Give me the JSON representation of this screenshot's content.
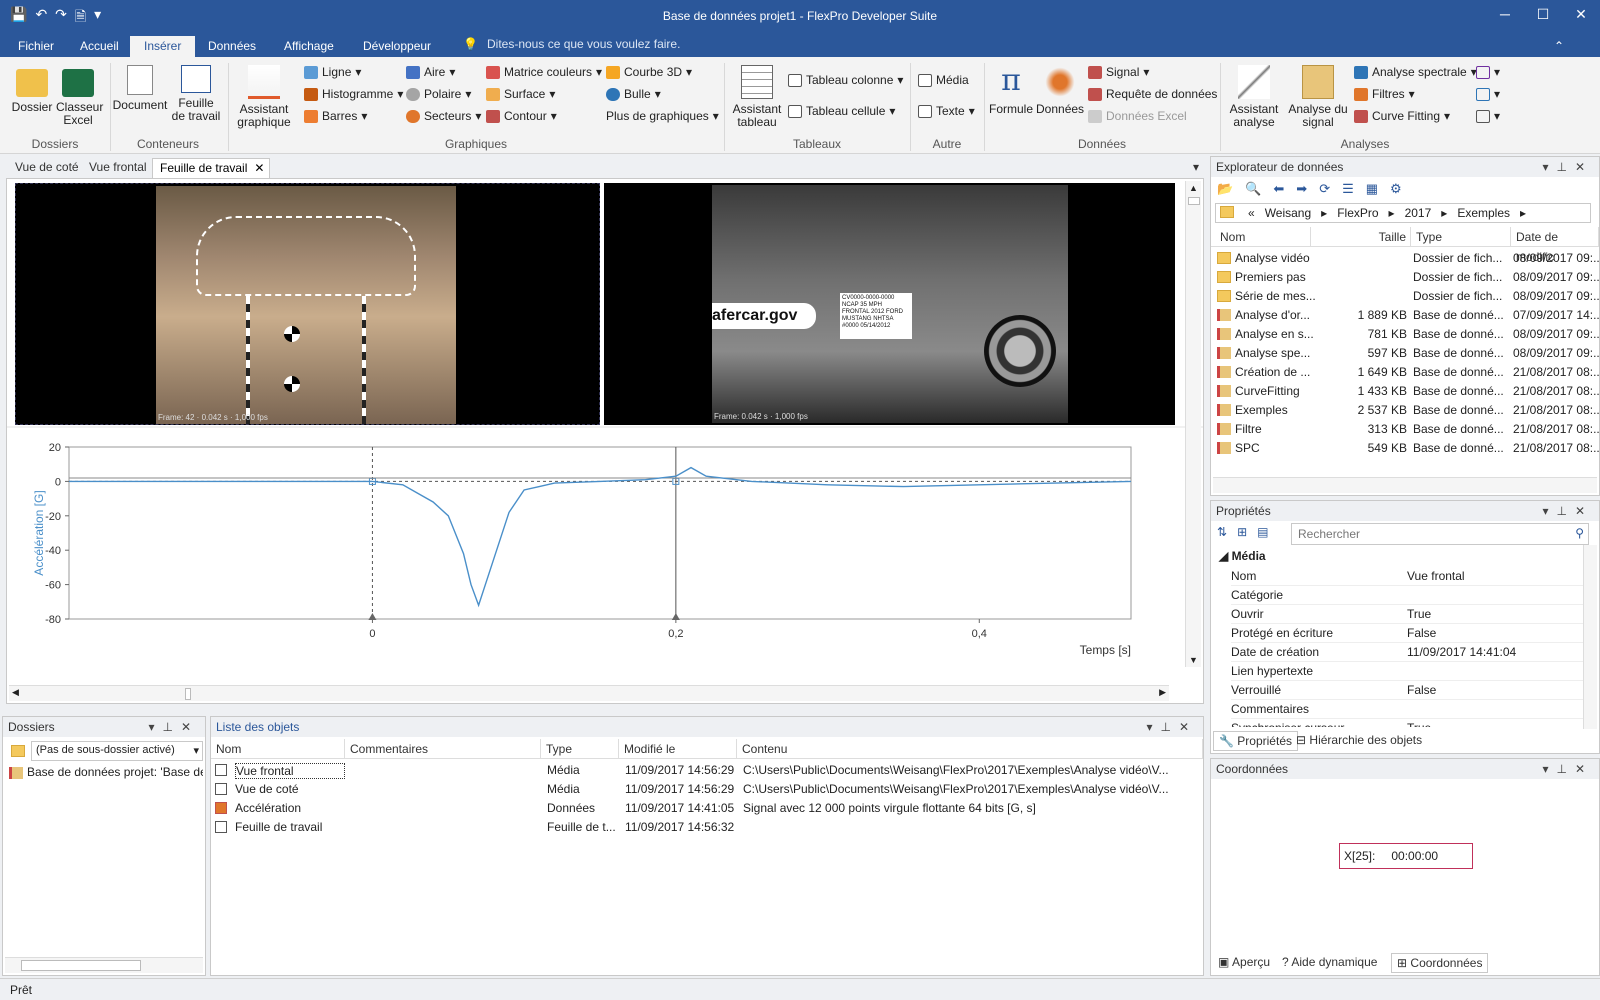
{
  "window": {
    "title": "Base de données projet1 - FlexPro Developer Suite"
  },
  "ribbon_tabs": [
    "Fichier",
    "Accueil",
    "Insérer",
    "Données",
    "Affichage",
    "Développeur"
  ],
  "tell_me": "Dites-nous ce que vous voulez faire.",
  "ribbon": {
    "groups": [
      "Dossiers",
      "Conteneurs",
      "Graphiques",
      "Tableaux",
      "Autre",
      "Données",
      "Analyses"
    ],
    "big": [
      "Dossier",
      "Classeur Excel",
      "Document",
      "Feuille de travail",
      "Assistant graphique",
      "Assistant tableau",
      "Formule",
      "Données",
      "Assistant analyse",
      "Analyse du signal"
    ],
    "graph_items": [
      "Ligne",
      "Histogramme",
      "Barres",
      "Aire",
      "Polaire",
      "Secteurs",
      "Matrice couleurs",
      "Surface",
      "Contour",
      "Courbe 3D",
      "Bulle",
      "Plus de graphiques"
    ],
    "table_items": [
      "Tableau colonne",
      "Tableau cellule"
    ],
    "other_items": [
      "Média",
      "Texte"
    ],
    "data_items": [
      "Signal",
      "Requête de données",
      "Données Excel"
    ],
    "analysis_items": [
      "Analyse spectrale",
      "Filtres",
      "Curve Fitting"
    ]
  },
  "doc_tabs": [
    "Vue de coté",
    "Vue frontal",
    "Feuille de travail"
  ],
  "videos": {
    "left_caption": "Frame: 42 · 0.042 s · 1,000 fps",
    "right_caption": "Frame: 0.042 s · 1,000 fps",
    "right_logo": "afercar.gov",
    "right_label": "CV0000-0000-0000 NCAP 35 MPH FRONTAL 2012 FORD MUSTANG NHTSA #0000 05/14/2012"
  },
  "chart_data": {
    "type": "line",
    "ylabel": "Accélération [G]",
    "xlabel": "Temps [s]",
    "xlim": [
      -0.2,
      0.5
    ],
    "ylim": [
      -80,
      20
    ],
    "yticks": [
      20,
      0,
      -20,
      -40,
      -60,
      -80
    ],
    "xticks": [
      0,
      0.2,
      0.4
    ],
    "xtick_labels": [
      "0",
      "0,2",
      "0,4"
    ],
    "cursors": [
      0,
      0.2
    ],
    "series": [
      {
        "x": [
          -0.2,
          -0.1,
          0,
          0.02,
          0.03,
          0.04,
          0.05,
          0.06,
          0.065,
          0.07,
          0.08,
          0.09,
          0.1,
          0.11,
          0.12,
          0.15,
          0.18,
          0.2,
          0.21,
          0.22,
          0.25,
          0.3,
          0.35,
          0.4,
          0.45,
          0.5
        ],
        "y": [
          0,
          0,
          0,
          -2,
          -7,
          -12,
          -20,
          -42,
          -60,
          -72,
          -45,
          -18,
          -5,
          -3,
          -1,
          0,
          1,
          3,
          8,
          3,
          0,
          -2,
          -3,
          -2,
          -1,
          0
        ]
      }
    ]
  },
  "explorer": {
    "title": "Explorateur de données",
    "path": [
      "«",
      "Weisang",
      "FlexPro",
      "2017",
      "Exemples"
    ],
    "columns": [
      "Nom",
      "Taille",
      "Type",
      "Date de modific"
    ],
    "rows": [
      [
        "Analyse vidéo",
        "",
        "Dossier de fich...",
        "08/09/2017 09:.."
      ],
      [
        "Premiers pas",
        "",
        "Dossier de fich...",
        "08/09/2017 09:.."
      ],
      [
        "Série de mes...",
        "",
        "Dossier de fich...",
        "08/09/2017 09:.."
      ],
      [
        "Analyse d'or...",
        "1 889 KB",
        "Base de donné...",
        "07/09/2017 14:.."
      ],
      [
        "Analyse en s...",
        "781 KB",
        "Base de donné...",
        "08/09/2017 09:.."
      ],
      [
        "Analyse spe...",
        "597 KB",
        "Base de donné...",
        "08/09/2017 09:.."
      ],
      [
        "Création de ...",
        "1 649 KB",
        "Base de donné...",
        "21/08/2017 08:.."
      ],
      [
        "CurveFitting",
        "1 433 KB",
        "Base de donné...",
        "21/08/2017 08:.."
      ],
      [
        "Exemples",
        "2 537 KB",
        "Base de donné...",
        "21/08/2017 08:.."
      ],
      [
        "Filtre",
        "313 KB",
        "Base de donné...",
        "21/08/2017 08:.."
      ],
      [
        "SPC",
        "549 KB",
        "Base de donné...",
        "21/08/2017 08:.."
      ]
    ]
  },
  "properties": {
    "title": "Propriétés",
    "search_placeholder": "Rechercher",
    "section": "Média",
    "rows": [
      [
        "Nom",
        "Vue frontal"
      ],
      [
        "Catégorie",
        ""
      ],
      [
        "Ouvrir",
        "True"
      ],
      [
        "Protégé en écriture",
        "False"
      ],
      [
        "Date de création",
        "11/09/2017 14:41:04"
      ],
      [
        "Lien hypertexte",
        ""
      ],
      [
        "Verrouillé",
        "False"
      ],
      [
        "Commentaires",
        ""
      ],
      [
        "Synchroniser curseur",
        "True"
      ]
    ],
    "tabs": [
      "Propriétés",
      "Hiérarchie des objets"
    ]
  },
  "coords": {
    "title": "Coordonnées",
    "label": "X[25]:",
    "value": "00:00:00",
    "tabs": [
      "Aperçu",
      "Aide dynamique",
      "Coordonnées"
    ]
  },
  "dossiers": {
    "title": "Dossiers",
    "select": "(Pas de sous-dossier activé)",
    "item": "Base de données projet: 'Base de c"
  },
  "objects": {
    "title": "Liste des objets",
    "columns": [
      "Nom",
      "Commentaires",
      "Type",
      "Modifié le",
      "Contenu"
    ],
    "rows": [
      [
        "Vue frontal",
        "",
        "Média",
        "11/09/2017 14:56:29",
        "C:\\Users\\Public\\Documents\\Weisang\\FlexPro\\2017\\Exemples\\Analyse vidéo\\V..."
      ],
      [
        "Vue de coté",
        "",
        "Média",
        "11/09/2017 14:56:29",
        "C:\\Users\\Public\\Documents\\Weisang\\FlexPro\\2017\\Exemples\\Analyse vidéo\\V..."
      ],
      [
        "Accélération",
        "",
        "Données",
        "11/09/2017 14:41:05",
        "Signal avec 12 000 points virgule flottante 64 bits [G, s]"
      ],
      [
        "Feuille de travail",
        "",
        "Feuille de t...",
        "11/09/2017 14:56:32",
        ""
      ]
    ]
  },
  "status": "Prêt",
  "colors": {
    "accent": "#2b579a",
    "series": "#4a8fc9"
  }
}
